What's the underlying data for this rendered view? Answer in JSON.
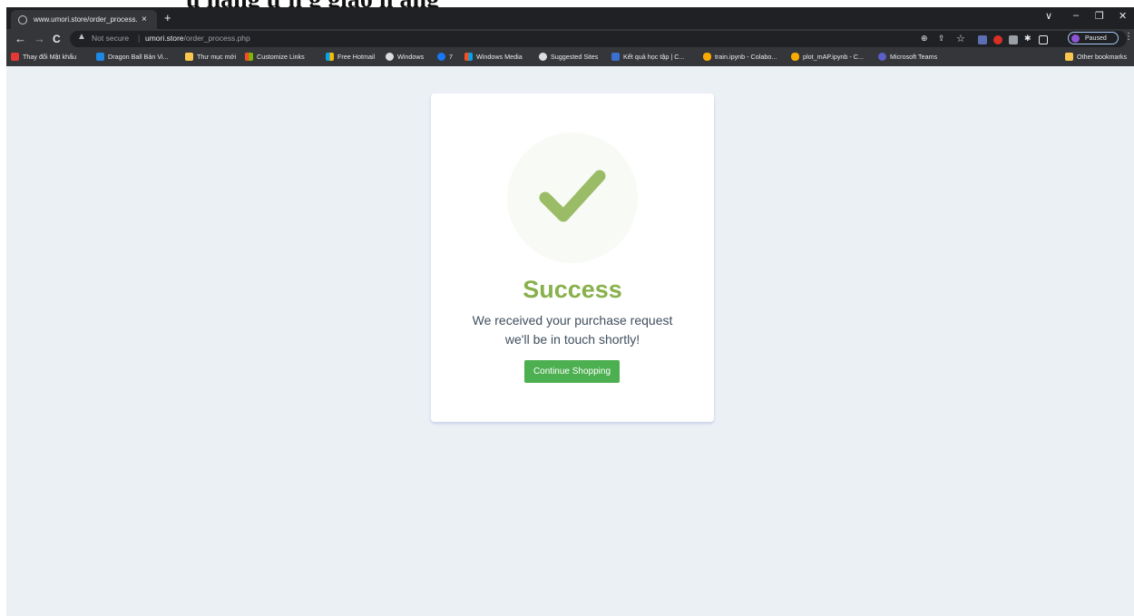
{
  "browser": {
    "tab_title": "www.umori.store/order_process.",
    "tab_close": "×",
    "new_tab": "+",
    "window_controls": [
      "∨",
      "–",
      "❐",
      "✕"
    ],
    "security_label": "Not secure",
    "url_domain": "umori.store",
    "url_path": "/order_process.php",
    "profile_status": "Paused",
    "bookmarks": [
      "Thay đổi Mật khẩu",
      "Dragon Ball Bản Vi...",
      "Thư mục mới",
      "Customize Links",
      "Free Hotmail",
      "Windows",
      "7",
      "Windows Media",
      "Suggested Sites",
      "Kết quả học tập | C...",
      "train.ipynb - Colabo...",
      "plot_mAP.ipynb - C...",
      "Microsoft Teams"
    ],
    "other_bookmarks": "Other bookmarks"
  },
  "page": {
    "title": "Success",
    "message_line1": "We received your purchase request",
    "message_line2": "we'll be in touch shortly!",
    "button_label": "Continue Shopping"
  },
  "colors": {
    "accent": "#88b04b",
    "button": "#4caf50",
    "page_background": "#ebf0f5"
  }
}
